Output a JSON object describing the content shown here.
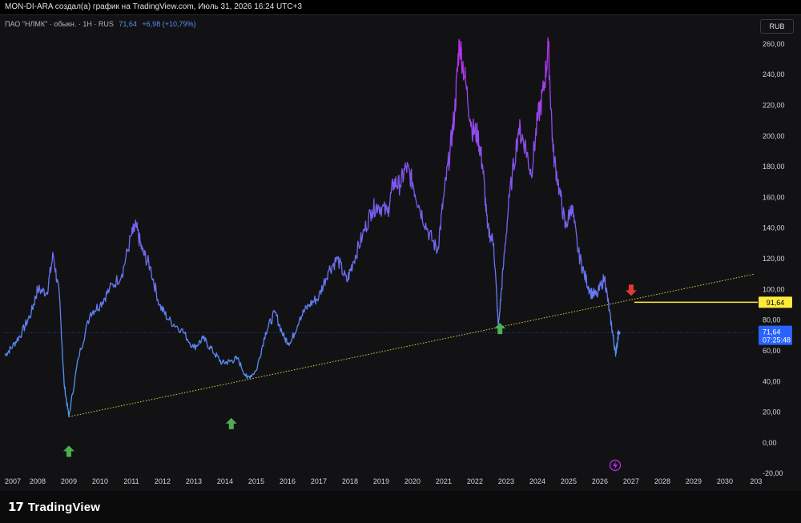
{
  "header": {
    "attribution": "MON-DI-ARA создал(а) график на TradingView.com, Июль 31, 2026 16:24 UTC+3"
  },
  "legend": {
    "symbol": "ПАО \"НЛМК\" · обыкн. · 1Н · RUS",
    "last": "71,64",
    "change": "+6,98 (+10,79%)"
  },
  "currency_button": "RUB",
  "footer": {
    "brand": "TradingView"
  },
  "chart_data": {
    "type": "line",
    "xlabel": "",
    "ylabel": "",
    "x_ticks": [
      "2007",
      "2008",
      "2009",
      "2010",
      "2011",
      "2012",
      "2013",
      "2014",
      "2015",
      "2016",
      "2017",
      "2018",
      "2019",
      "2020",
      "2021",
      "2022",
      "2023",
      "2024",
      "2025",
      "2026",
      "2027",
      "2028",
      "2029",
      "2030",
      "203"
    ],
    "y_ticks": [
      "-20,00",
      "0,00",
      "20,00",
      "40,00",
      "60,00",
      "80,00",
      "100,00",
      "120,00",
      "140,00",
      "160,00",
      "180,00",
      "200,00",
      "220,00",
      "240,00",
      "260,00"
    ],
    "ylim": [
      -22,
      273
    ],
    "xlim": [
      2006.95,
      2030.95
    ],
    "grid": false,
    "colors": {
      "low": "#4a9ff5",
      "mid": "#7a5cf0",
      "high": "#c02cf0",
      "trendline": "#d9d23a",
      "last_label": "#2962ff",
      "level_label": "#ffeb3b"
    },
    "series": [
      {
        "x": [
          2006.95,
          2007.2,
          2007.5,
          2007.8,
          2008.0,
          2008.3,
          2008.5,
          2008.7,
          2008.85,
          2009.0,
          2009.3,
          2009.7,
          2010.0,
          2010.3,
          2010.7,
          2011.0,
          2011.15,
          2011.35,
          2011.6,
          2011.9,
          2012.2,
          2012.6,
          2013.0,
          2013.3,
          2013.6,
          2013.9,
          2014.15,
          2014.4,
          2014.7,
          2015.0,
          2015.3,
          2015.6,
          2015.9,
          2016.1,
          2016.4,
          2016.7,
          2017.0,
          2017.3,
          2017.6,
          2017.9,
          2018.1,
          2018.4,
          2018.7,
          2018.9,
          2019.2,
          2019.4,
          2019.6,
          2019.8,
          2020.0,
          2020.2,
          2020.5,
          2020.8,
          2021.0,
          2021.2,
          2021.35,
          2021.5,
          2021.7,
          2021.9,
          2022.1,
          2022.25,
          2022.4,
          2022.6,
          2022.75,
          2022.9,
          2023.1,
          2023.4,
          2023.6,
          2023.8,
          2024.0,
          2024.2,
          2024.35,
          2024.5,
          2024.7,
          2024.9,
          2025.1,
          2025.3,
          2025.5,
          2025.7,
          2025.9,
          2026.15,
          2026.3,
          2026.42,
          2026.5,
          2026.55,
          2026.6
        ],
        "values": [
          57,
          63,
          72,
          85,
          100,
          98,
          123,
          95,
          38,
          17,
          55,
          85,
          90,
          100,
          110,
          135,
          141,
          125,
          115,
          90,
          80,
          74,
          62,
          68,
          60,
          52,
          53,
          55,
          42,
          47,
          72,
          85,
          68,
          65,
          82,
          90,
          95,
          112,
          120,
          105,
          118,
          135,
          152,
          155,
          150,
          170,
          168,
          180,
          170,
          155,
          138,
          125,
          160,
          190,
          215,
          262,
          235,
          205,
          200,
          180,
          140,
          130,
          75,
          113,
          160,
          205,
          195,
          175,
          210,
          230,
          258,
          190,
          165,
          140,
          155,
          125,
          110,
          98,
          96,
          108,
          86,
          70,
          58,
          64,
          71.64
        ]
      }
    ],
    "trendline": {
      "x": [
        2009.0,
        2030.95
      ],
      "y": [
        17,
        110
      ]
    },
    "level_marker": {
      "label": "91,64",
      "value": 91.64
    },
    "last_value": {
      "price": "71,64",
      "countdown": "07:25:48",
      "value": 71.64
    },
    "markers": [
      {
        "type": "up",
        "x": 2009.0,
        "y": -6,
        "color": "#4caf50"
      },
      {
        "type": "up",
        "x": 2014.2,
        "y": 12,
        "color": "#4caf50"
      },
      {
        "type": "up",
        "x": 2022.8,
        "y": 74,
        "color": "#4caf50"
      },
      {
        "type": "down",
        "x": 2027.0,
        "y": 100,
        "color": "#e53935"
      }
    ]
  }
}
